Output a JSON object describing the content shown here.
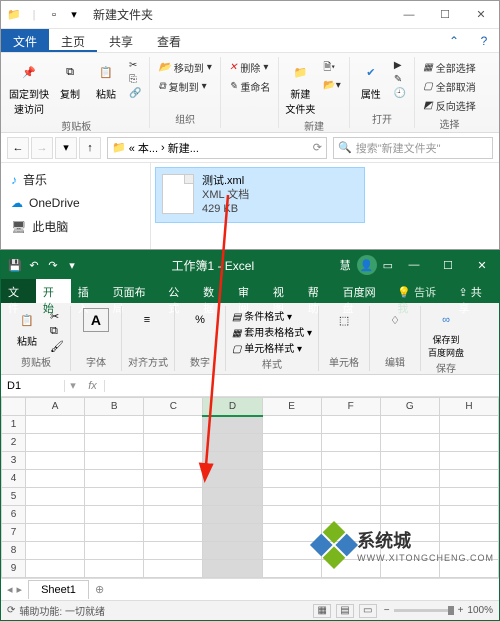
{
  "fe": {
    "title": "新建文件夹",
    "tabs": {
      "file": "文件",
      "home": "主页",
      "share": "共享",
      "view": "查看"
    },
    "ribbon": {
      "clipboard": {
        "label": "剪贴板",
        "pin": "固定到快\n速访问",
        "copy": "复制",
        "paste": "粘贴"
      },
      "organize": {
        "label": "组织",
        "moveto": "移动到",
        "copyto": "复制到",
        "delete": "删除",
        "rename": "重命名"
      },
      "new": {
        "label": "新建",
        "newfolder": "新建\n文件夹"
      },
      "open": {
        "label": "打开",
        "props": "属性"
      },
      "select": {
        "label": "选择",
        "selall": "全部选择",
        "selnone": "全部取消",
        "selinv": "反向选择"
      }
    },
    "address": {
      "root": "« 本...",
      "crumb": "新建...",
      "search_ph": "搜索\"新建文件夹\""
    },
    "sidebar": {
      "music": "音乐",
      "onedrive": "OneDrive",
      "thispc": "此电脑"
    },
    "file": {
      "name": "测试.xml",
      "type": "XML 文档",
      "size": "429 KB"
    }
  },
  "ex": {
    "title": "工作簿1 - Excel",
    "user": "慧",
    "tabs": {
      "file": "文件",
      "home": "开始",
      "insert": "插入",
      "layout": "页面布局",
      "formulas": "公式",
      "data": "数据",
      "review": "审阅",
      "view": "视图",
      "help": "帮助",
      "baidu": "百度网盘",
      "tell": "告诉我",
      "share": "共享"
    },
    "ribbon": {
      "clipboard": {
        "label": "剪贴板",
        "paste": "粘贴"
      },
      "font": "字体",
      "align": "对齐方式",
      "number": "数字",
      "styles": {
        "label": "样式",
        "cond": "条件格式",
        "tablefmt": "套用表格格式",
        "cellfmt": "单元格样式"
      },
      "cells": "单元格",
      "editing": "编辑",
      "save": {
        "label": "保存",
        "btn": "保存到\n百度网盘"
      }
    },
    "namebox": "D1",
    "cols": [
      "A",
      "B",
      "C",
      "D",
      "E",
      "F",
      "G",
      "H"
    ],
    "rows": 9,
    "sheet": "Sheet1",
    "status": "辅助功能: 一切就绪",
    "zoom": "100%"
  },
  "watermark": {
    "brand": "系统城",
    "sub": "WWW.XITONGCHENG.COM"
  }
}
